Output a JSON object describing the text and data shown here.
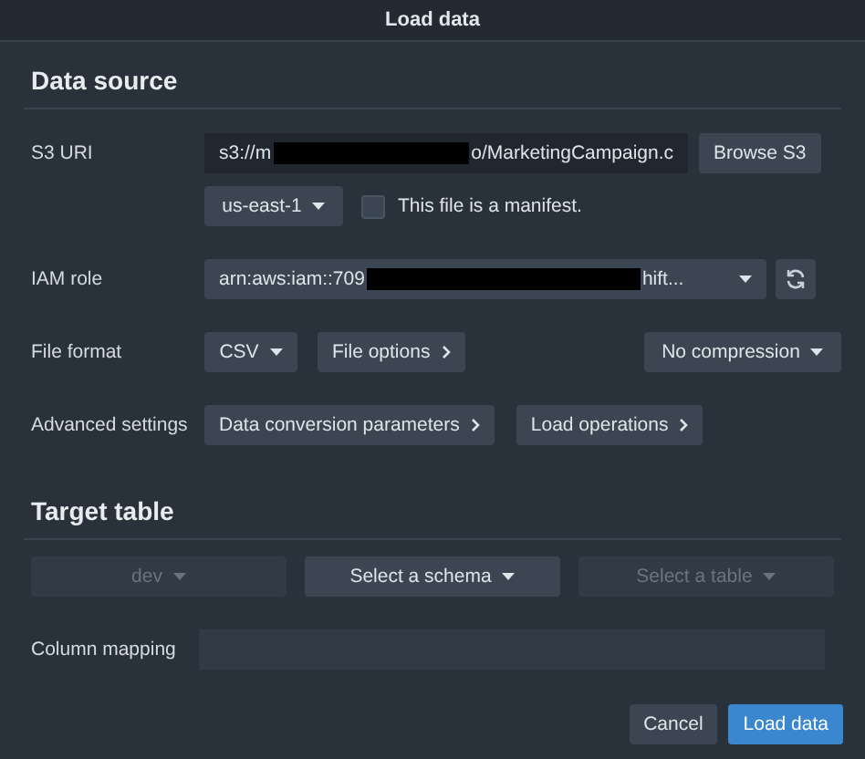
{
  "dialog": {
    "title": "Load data"
  },
  "data_source": {
    "heading": "Data source",
    "s3_uri": {
      "label": "S3 URI",
      "value_parts": [
        "s3://m",
        "o/MarketingCampaign.c"
      ],
      "browse_button": "Browse S3"
    },
    "region": {
      "value": "us-east-1"
    },
    "manifest": {
      "label": "This file is a manifest.",
      "checked": false
    },
    "iam_role": {
      "label": "IAM role",
      "value_parts": [
        "arn:aws:iam::709",
        "hift..."
      ]
    },
    "file_format": {
      "label": "File format",
      "format": "CSV",
      "options_button": "File options",
      "compression": "No compression"
    },
    "advanced": {
      "label": "Advanced settings",
      "buttons": [
        "Data conversion parameters",
        "Load operations"
      ]
    }
  },
  "target_table": {
    "heading": "Target table",
    "selects": [
      {
        "value": "dev",
        "disabled": true
      },
      {
        "value": "Select a schema",
        "disabled": false
      },
      {
        "value": "Select a table",
        "disabled": true
      }
    ],
    "column_mapping": {
      "label": "Column mapping"
    }
  },
  "footer": {
    "buttons": [
      {
        "label": "Cancel",
        "kind": "secondary"
      },
      {
        "label": "Load data",
        "kind": "primary"
      }
    ]
  }
}
